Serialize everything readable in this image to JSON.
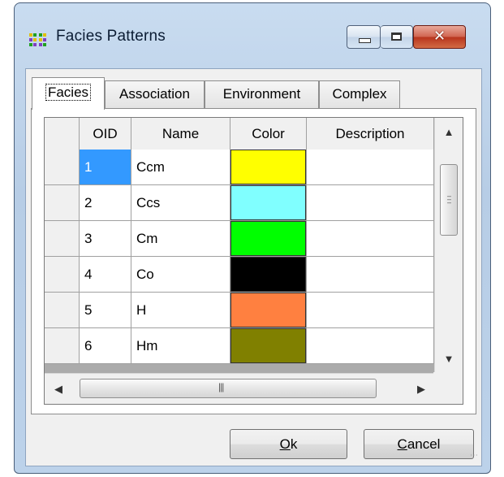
{
  "window": {
    "title": "Facies Patterns",
    "icon": "facies-app-icon",
    "controls": {
      "minimize": "minimize-icon",
      "maximize": "maximize-icon",
      "close": "close-icon"
    }
  },
  "tabs": [
    {
      "label": "Facies",
      "active": true
    },
    {
      "label": "Association",
      "active": false
    },
    {
      "label": "Environment",
      "active": false
    },
    {
      "label": "Complex",
      "active": false
    }
  ],
  "grid": {
    "columns": [
      "OID",
      "Name",
      "Color",
      "Description"
    ],
    "rows": [
      {
        "oid": "1",
        "name": "Ccm",
        "color": "#ffff00",
        "description": ""
      },
      {
        "oid": "2",
        "name": "Ccs",
        "color": "#80ffff",
        "description": ""
      },
      {
        "oid": "3",
        "name": "Cm",
        "color": "#00ff00",
        "description": ""
      },
      {
        "oid": "4",
        "name": "Co",
        "color": "#000000",
        "description": ""
      },
      {
        "oid": "5",
        "name": "H",
        "color": "#ff8040",
        "description": ""
      },
      {
        "oid": "6",
        "name": "Hm",
        "color": "#808000",
        "description": ""
      }
    ],
    "selected_row": 0
  },
  "buttons": {
    "ok_label": "Ok",
    "cancel_label": "Cancel"
  },
  "colors": {
    "selection": "#3399ff",
    "close_button": "#c8462b"
  }
}
